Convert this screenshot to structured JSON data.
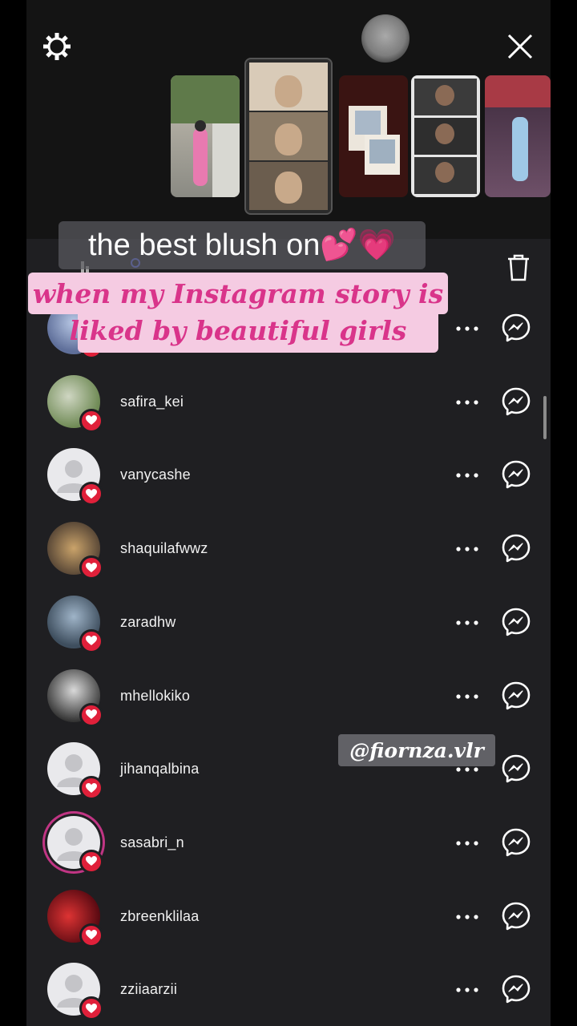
{
  "caption": {
    "line1": "the best blush on💕💗",
    "line2": "when my Instagram story is liked by beautiful girls"
  },
  "watermark": "@fiornza.vlr",
  "colors": {
    "background": "#1f1f22",
    "heart": "#e0203a",
    "caption_pink": "#d9348a",
    "caption_bg": "#f5cbe2"
  },
  "icons": {
    "settings": "gear-icon",
    "close": "close-icon",
    "delete": "trash-icon",
    "more": "more-dots-icon",
    "message": "messenger-icon",
    "like": "heart-icon"
  },
  "viewers": [
    {
      "username": "",
      "avatar": "photo"
    },
    {
      "username": "safira_kei",
      "avatar": "photo"
    },
    {
      "username": "vanycashe",
      "avatar": "default"
    },
    {
      "username": "shaquilafwwz",
      "avatar": "photo"
    },
    {
      "username": "zaradhw",
      "avatar": "photo"
    },
    {
      "username": "mhellokiko",
      "avatar": "photo"
    },
    {
      "username": "jihanqalbina",
      "avatar": "default"
    },
    {
      "username": "sasabri_n",
      "avatar": "default-story-ring"
    },
    {
      "username": "zbreenklilaa",
      "avatar": "photo"
    },
    {
      "username": "zziiaarzii",
      "avatar": "default"
    }
  ]
}
